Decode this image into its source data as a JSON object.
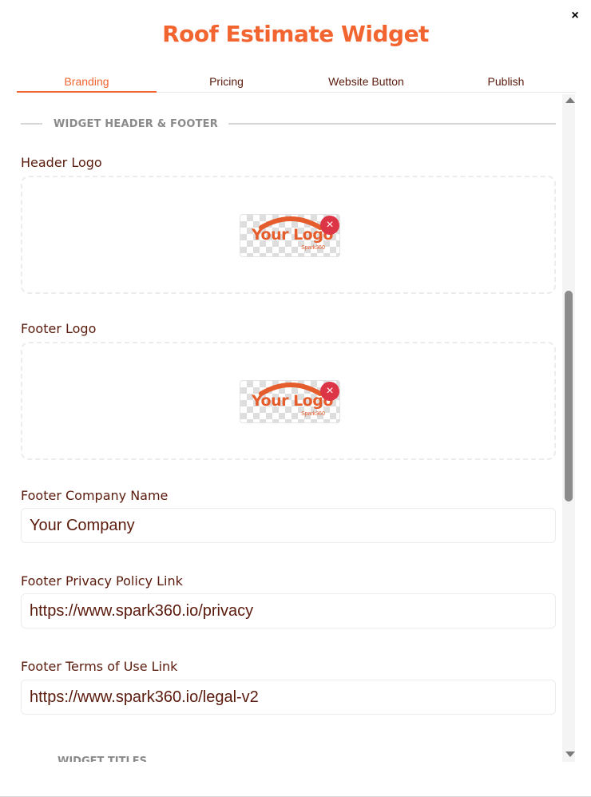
{
  "modal": {
    "title": "Roof Estimate Widget",
    "close_label": "×"
  },
  "tabs": [
    {
      "label": "Branding",
      "active": true
    },
    {
      "label": "Pricing",
      "active": false
    },
    {
      "label": "Website Button",
      "active": false
    },
    {
      "label": "Publish",
      "active": false
    }
  ],
  "section": {
    "header_footer_label": "WIDGET HEADER & FOOTER",
    "next_section_label": "WIDGET TITLES"
  },
  "fields": {
    "header_logo": {
      "label": "Header Logo",
      "logo_text": "Your Logo",
      "logo_brand": "Spark360",
      "remove_label": "×"
    },
    "footer_logo": {
      "label": "Footer Logo",
      "logo_text": "Your Logo",
      "logo_brand": "Spark360",
      "remove_label": "×"
    },
    "footer_company_name": {
      "label": "Footer Company Name",
      "value": "Your Company"
    },
    "footer_privacy_link": {
      "label": "Footer Privacy Policy Link",
      "value": "https://www.spark360.io/privacy"
    },
    "footer_terms_link": {
      "label": "Footer Terms of Use Link",
      "value": "https://www.spark360.io/legal-v2"
    }
  },
  "colors": {
    "accent": "#f26430",
    "text": "#5a1a0c",
    "remove": "#dc3545",
    "section_label": "#8a8a8a"
  }
}
